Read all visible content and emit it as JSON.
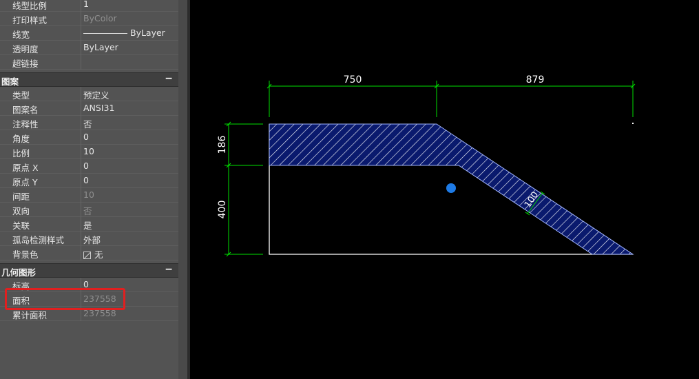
{
  "properties": {
    "top_rows": [
      {
        "label": "线型比例",
        "value": "1",
        "dim": false
      },
      {
        "label": "打印样式",
        "value": "ByColor",
        "dim": true
      },
      {
        "label": "线宽",
        "value": "ByLayer",
        "dim": false
      },
      {
        "label": "透明度",
        "value": "ByLayer",
        "dim": false
      },
      {
        "label": "超链接",
        "value": "",
        "dim": false
      }
    ],
    "hatch_section": {
      "title": "图案",
      "collapse": "−",
      "rows": [
        {
          "label": "类型",
          "value": "预定义",
          "dim": false
        },
        {
          "label": "图案名",
          "value": "ANSI31",
          "dim": false
        },
        {
          "label": "注释性",
          "value": "否",
          "dim": false
        },
        {
          "label": "角度",
          "value": "0",
          "dim": false
        },
        {
          "label": "比例",
          "value": "10",
          "dim": false
        },
        {
          "label": "原点 X",
          "value": "0",
          "dim": false
        },
        {
          "label": "原点 Y",
          "value": "0",
          "dim": false
        },
        {
          "label": "间距",
          "value": "10",
          "dim": true
        },
        {
          "label": "双向",
          "value": "否",
          "dim": true
        },
        {
          "label": "关联",
          "value": "是",
          "dim": false
        },
        {
          "label": "孤岛检测样式",
          "value": "外部",
          "dim": false
        },
        {
          "label": "背景色",
          "value": "无",
          "dim": false
        }
      ]
    },
    "geometry_section": {
      "title": "几何图形",
      "collapse": "−",
      "rows": [
        {
          "label": "标高",
          "value": "0",
          "dim": false
        },
        {
          "label": "面积",
          "value": "237558",
          "dim": true
        },
        {
          "label": "累计面积",
          "value": "237558",
          "dim": true
        }
      ]
    }
  },
  "drawing": {
    "dimensions": {
      "top_left": "750",
      "top_right": "879",
      "left_upper": "186",
      "left_lower": "400",
      "slope_thickness": "100"
    }
  },
  "colors": {
    "panel_bg": "#535353",
    "section_bg": "#3f3f3f",
    "highlight": "#e02020",
    "dimension": "#00e000",
    "hatch_fill": "#0a1a6e",
    "hatch_line": "#ffffff",
    "grip": "#1e7be6"
  }
}
